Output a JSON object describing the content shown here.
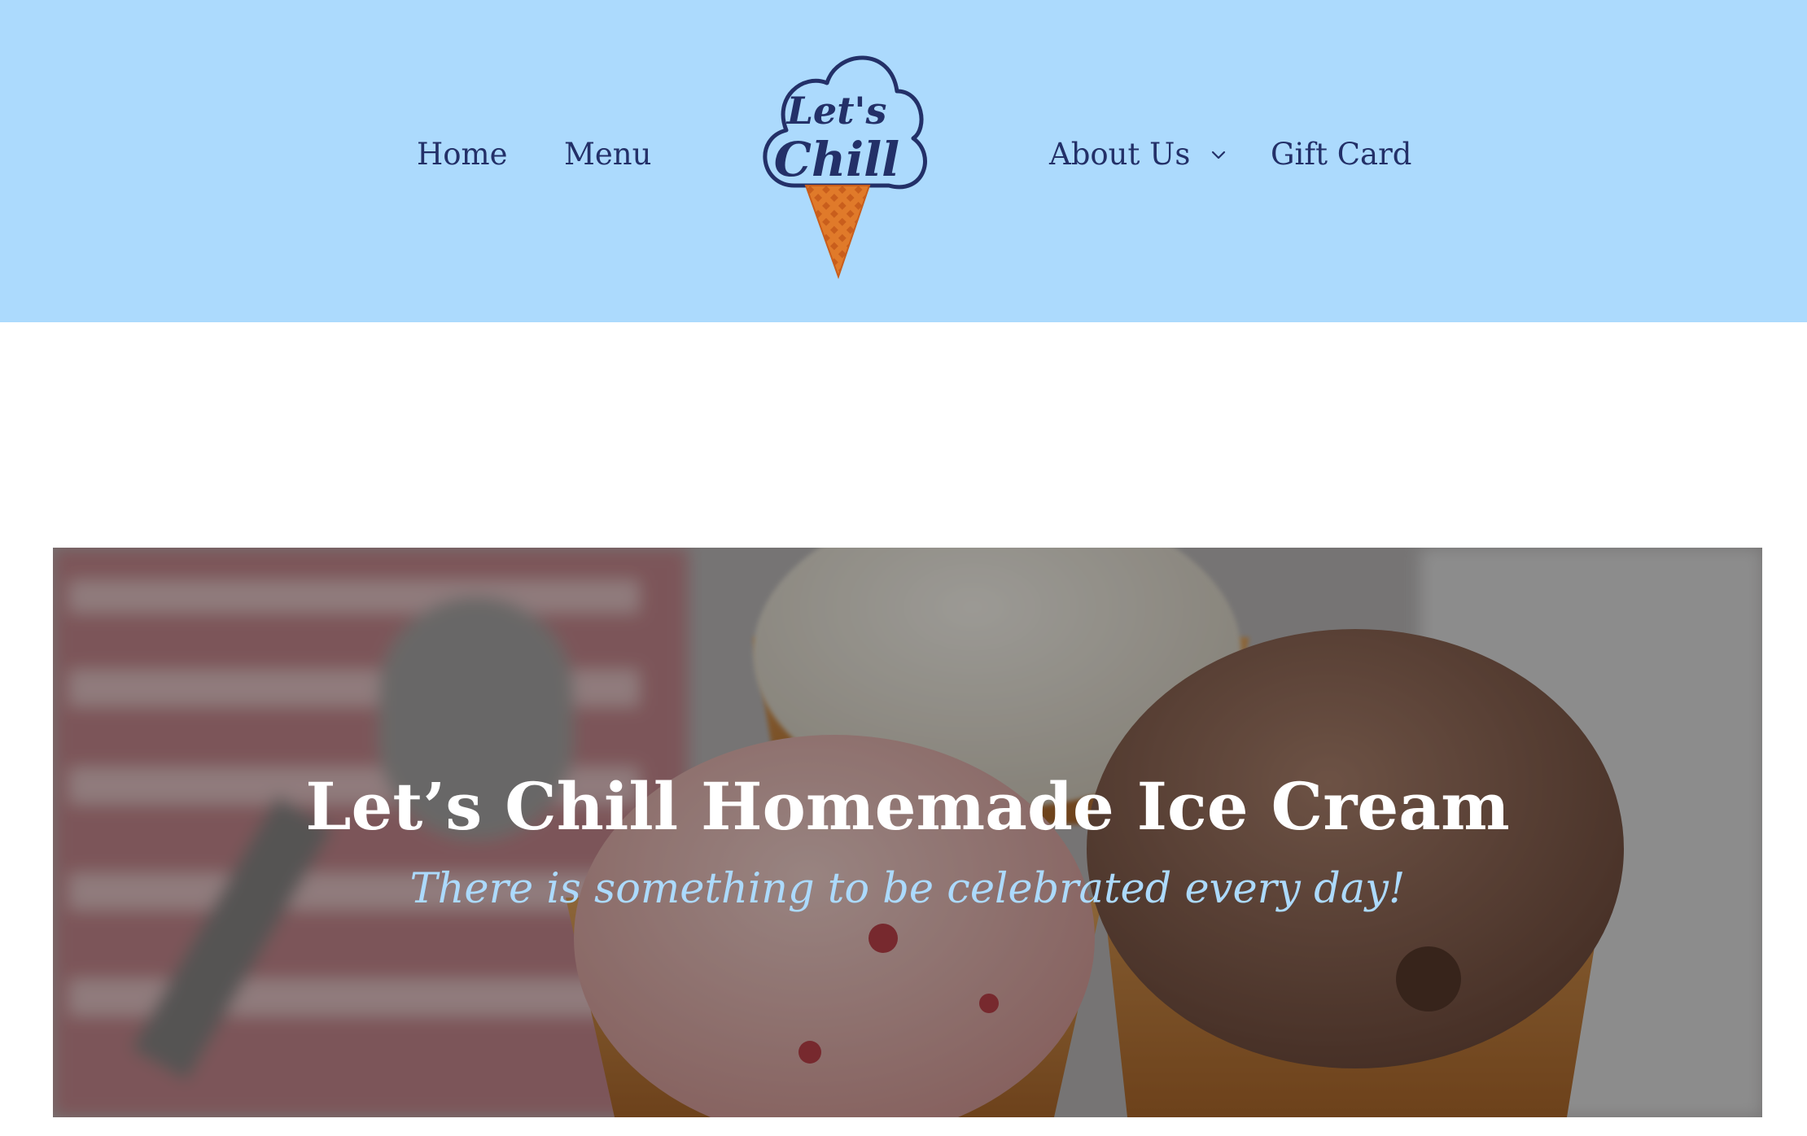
{
  "header": {
    "background_color": "#acdafd",
    "text_color": "#233068",
    "nav_left": [
      {
        "label": "Home"
      },
      {
        "label": "Menu"
      }
    ],
    "nav_right": [
      {
        "label": "About Us",
        "has_dropdown": true,
        "dropdown_icon": "chevron-down-icon"
      },
      {
        "label": "Gift Card"
      }
    ],
    "logo": {
      "text_line1": "Let's",
      "text_line2": "Chill",
      "icon": "ice-cream-cone-logo",
      "cone_color": "#e07a2a"
    }
  },
  "hero": {
    "title": "Let’s Chill Homemade Ice Cream",
    "subtitle": "There is something to be celebrated every day!",
    "subtitle_color": "#acdafd",
    "background_image": "ice-cream-cones-photo"
  }
}
